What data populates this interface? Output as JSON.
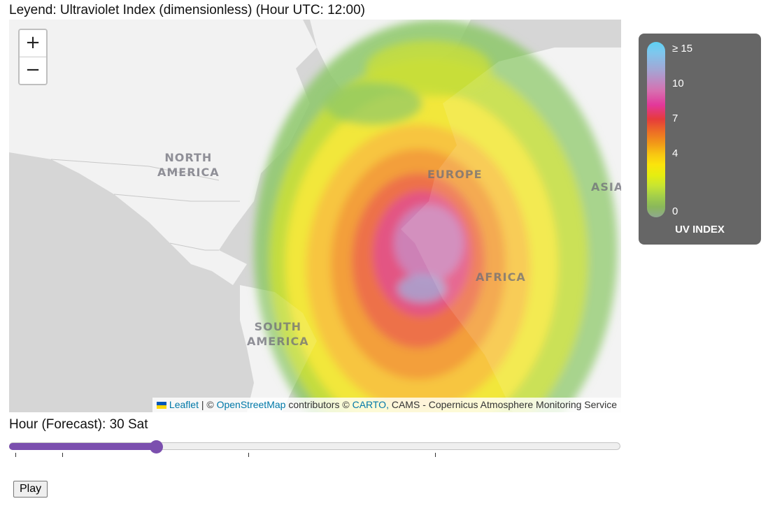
{
  "page": {
    "legend_heading": "Leyend: Ultraviolet Index (dimensionless) (Hour UTC: 12:00)"
  },
  "map": {
    "zoom_in_label": "+",
    "zoom_out_label": "−",
    "labels": {
      "north_america": "NORTH\nAMERICA",
      "europe": "EUROPE",
      "asia": "ASIA",
      "africa": "AFRICA",
      "south_america": "SOUTH\nAMERICA"
    },
    "attribution": {
      "leaflet": "Leaflet",
      "sep1": " | © ",
      "osm": "OpenStreetMap",
      "sep2": " contributors © ",
      "carto": "CARTO,",
      "cams": " CAMS - Copernicus Atmosphere Monitoring Service"
    }
  },
  "legend": {
    "ticks": [
      "≥ 15",
      "10",
      "7",
      "4",
      "0"
    ],
    "title": "UV INDEX",
    "colors": {
      "max": "#5ed1f3",
      "high": "#d76fb0",
      "mid": "#e63b3b",
      "moderate": "#fbe40c",
      "low": "#8fa88f"
    }
  },
  "controls": {
    "hour_label": "Hour (Forecast): 30 Sat",
    "slider_position": 0.24,
    "play_label": "Play",
    "accent_color": "#7b4fae"
  }
}
